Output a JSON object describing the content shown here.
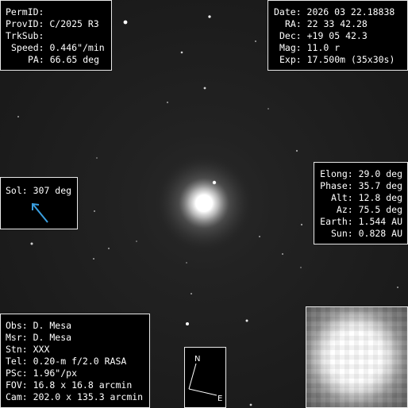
{
  "header_left": {
    "perm_id": "PermID:",
    "prov_id": "ProvID: C/2025 R3",
    "trk_sub": "TrkSub:",
    "speed": "Speed: 0.446\"/min",
    "pa": "PA: 66.65 deg"
  },
  "header_right": {
    "date": "Date: 2026 03 22.18838",
    "ra": "RA: 22 33 42.28",
    "dec": "Dec: +19 05 42.3",
    "mag": "Mag: 11.0 r",
    "exp": "Exp: 17.500m (35x30s)"
  },
  "sol": {
    "label": "Sol: 307 deg",
    "arrow_color": "#3a9fe0"
  },
  "geometry": {
    "elong": "Elong: 29.0 deg",
    "phase": "Phase: 35.7 deg",
    "alt": "Alt: 12.8 deg",
    "az": "Az: 75.5 deg",
    "earth": "Earth: 1.544 AU",
    "sun": "Sun: 0.828 AU"
  },
  "observer": {
    "obs": "Obs: D. Mesa",
    "msr": "Msr: D. Mesa",
    "stn": "Stn: XXX",
    "tel": "Tel: 0.20-m f/2.0 RASA",
    "psc": "PSc: 1.96\"/px",
    "fov": "FOV: 16.8 x 16.8 arcmin",
    "cam": "Cam: 202.0 x 135.3 arcmin"
  },
  "compass": {
    "north": "N",
    "east": "E"
  }
}
